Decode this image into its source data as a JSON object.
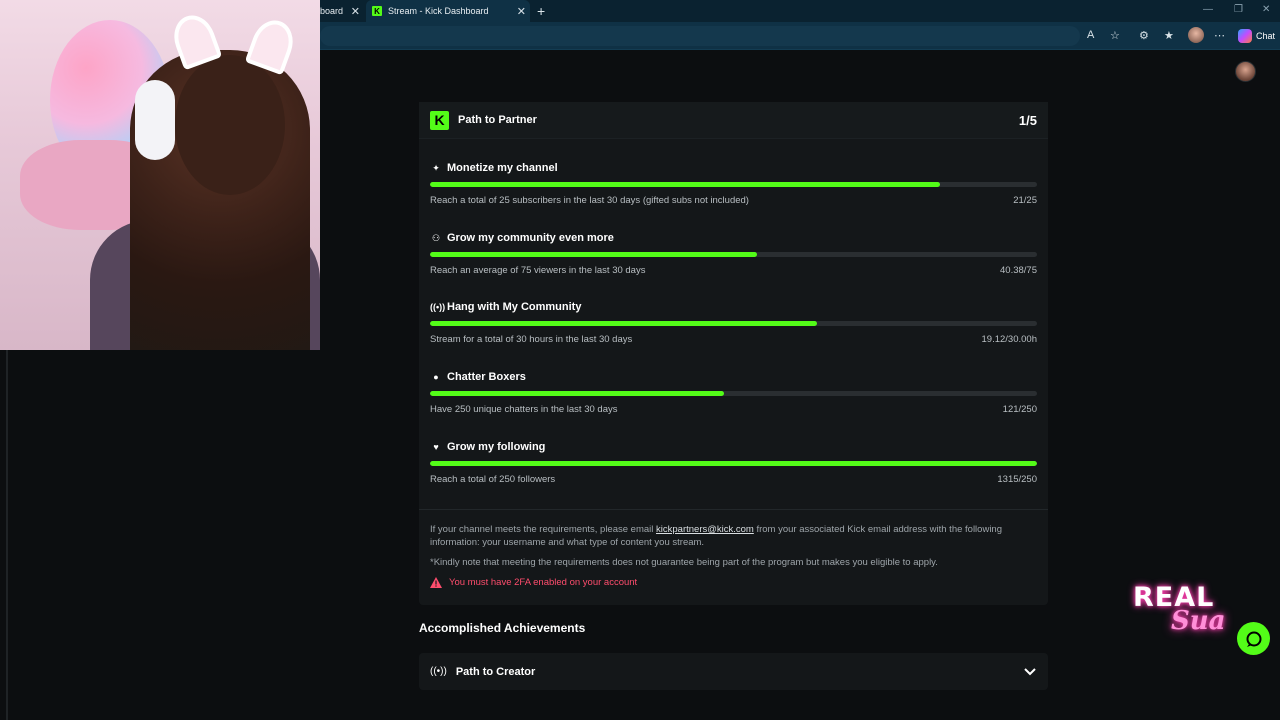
{
  "browser": {
    "tabs": [
      {
        "label": "board",
        "active": false
      },
      {
        "label": "Stream - Kick Dashboard",
        "active": true
      }
    ],
    "chat_label": "Chat"
  },
  "path_to_partner": {
    "title": "Path to Partner",
    "count": "1/5",
    "goals": [
      {
        "icon": "sparkle-icon",
        "title": "Monetize my channel",
        "description": "Reach a total of 25 subscribers in the last 30 days (gifted subs not included)",
        "value": "21/25",
        "progress": 0.84
      },
      {
        "icon": "community-icon",
        "title": "Grow my community even more",
        "description": "Reach an average of 75 viewers in the last 30 days",
        "value": "40.38/75",
        "progress": 0.538
      },
      {
        "icon": "broadcast-icon",
        "title": "Hang with My Community",
        "description": "Stream for a total of 30 hours in the last 30 days",
        "value": "19.12/30.00h",
        "progress": 0.637
      },
      {
        "icon": "chat-bubble-icon",
        "title": "Chatter Boxers",
        "description": "Have 250 unique chatters in the last 30 days",
        "value": "121/250",
        "progress": 0.484
      },
      {
        "icon": "heart-icon",
        "title": "Grow my following",
        "description": "Reach a total of 250 followers",
        "value": "1315/250",
        "progress": 1.0
      }
    ],
    "note_prefix": "If your channel meets the requirements, please email ",
    "note_email": "kickpartners@kick.com",
    "note_suffix": " from your associated Kick email address with the following information: your username and what type of content you stream.",
    "disclaimer": "*Kindly note that meeting the requirements does not guarantee being part of the program but makes you eligible to apply.",
    "warning": "You must have 2FA enabled on your account"
  },
  "achievements": {
    "title": "Accomplished Achievements",
    "items": [
      {
        "label": "Path to Creator"
      }
    ]
  },
  "overlay": {
    "line1": "REAL",
    "line2": "Sua"
  },
  "colors": {
    "accent": "#53fc18",
    "warning": "#ff4d6d",
    "panel": "#141719",
    "background": "#0c0e10"
  }
}
